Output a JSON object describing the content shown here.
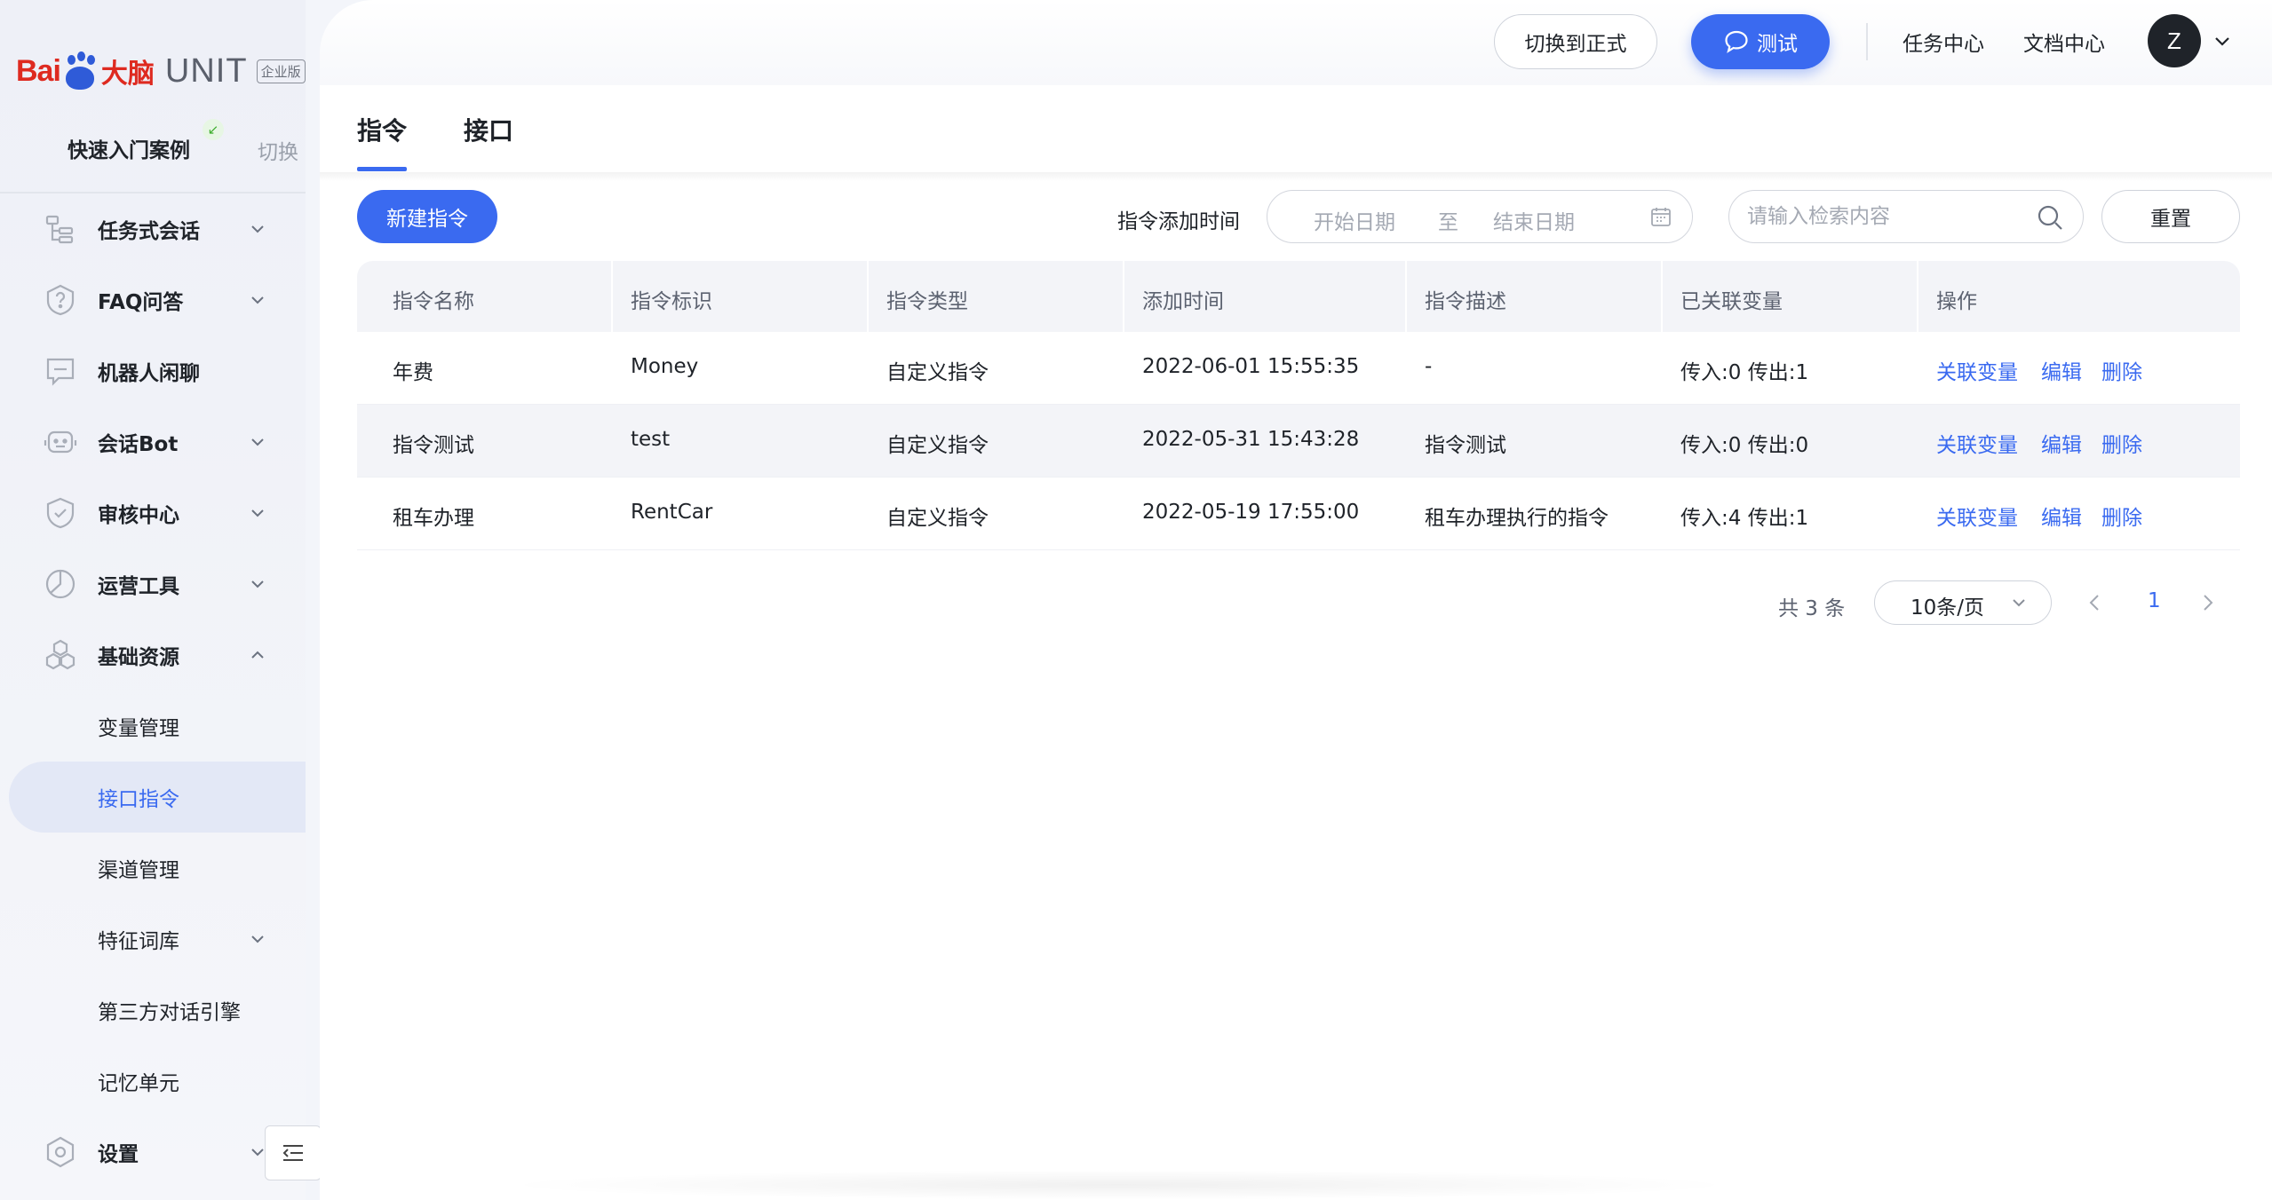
{
  "brand": {
    "logo_bai": "Bai",
    "logo_du": "du",
    "logo_brain": "大脑",
    "logo_unit": "UNIT",
    "edition": "企业版"
  },
  "sidebar": {
    "quick_start": "快速入门案例",
    "switch_label": "切换",
    "items": [
      {
        "label": "任务式会话",
        "icon": "task-dialog-icon",
        "chevron": "down"
      },
      {
        "label": "FAQ问答",
        "icon": "faq-icon",
        "chevron": "down"
      },
      {
        "label": "机器人闲聊",
        "icon": "chat-bubble-icon",
        "chevron": ""
      },
      {
        "label": "会话Bot",
        "icon": "bot-icon",
        "chevron": "down"
      },
      {
        "label": "审核中心",
        "icon": "shield-icon",
        "chevron": "down"
      },
      {
        "label": "运营工具",
        "icon": "pie-icon",
        "chevron": "down"
      },
      {
        "label": "基础资源",
        "icon": "cubes-icon",
        "chevron": "up"
      },
      {
        "label": "变量管理",
        "sub": true
      },
      {
        "label": "接口指令",
        "sub": true,
        "active": true
      },
      {
        "label": "渠道管理",
        "sub": true
      },
      {
        "label": "特征词库",
        "sub": true,
        "chevron": "down"
      },
      {
        "label": "第三方对话引擎",
        "sub": true
      },
      {
        "label": "记忆单元",
        "sub": true
      },
      {
        "label": "设置",
        "icon": "settings-icon",
        "chevron": "down"
      }
    ]
  },
  "topbar": {
    "switch_prod": "切换到正式",
    "test": "测试",
    "task_center": "任务中心",
    "doc_center": "文档中心",
    "avatar_letter": "Z"
  },
  "tabs": [
    {
      "label": "指令",
      "active": true
    },
    {
      "label": "接口",
      "active": false
    }
  ],
  "toolbar": {
    "new_button": "新建指令",
    "filter_label": "指令添加时间",
    "start_placeholder": "开始日期",
    "range_sep": "至",
    "end_placeholder": "结束日期",
    "search_placeholder": "请输入检索内容",
    "reset": "重置"
  },
  "table": {
    "columns": [
      "指令名称",
      "指令标识",
      "指令类型",
      "添加时间",
      "指令描述",
      "已关联变量",
      "操作"
    ],
    "rows": [
      {
        "name": "年费",
        "id": "Money",
        "type": "自定义指令",
        "time": "2022-06-01 15:55:35",
        "desc": "-",
        "vars": "传入:0 传出:1"
      },
      {
        "name": "指令测试",
        "id": "test",
        "type": "自定义指令",
        "time": "2022-05-31 15:43:28",
        "desc": "指令测试",
        "vars": "传入:0 传出:0"
      },
      {
        "name": "租车办理",
        "id": "RentCar",
        "type": "自定义指令",
        "time": "2022-05-19 17:55:00",
        "desc": "租车办理执行的指令",
        "vars": "传入:4 传出:1"
      }
    ],
    "actions": [
      "关联变量",
      "编辑",
      "删除"
    ]
  },
  "pagination": {
    "total": "共 3 条",
    "page_size": "10条/页",
    "current": "1"
  },
  "colors": {
    "primary": "#3a6af0",
    "brand_red": "#de2a20",
    "brand_blue": "#2f5bd8"
  }
}
